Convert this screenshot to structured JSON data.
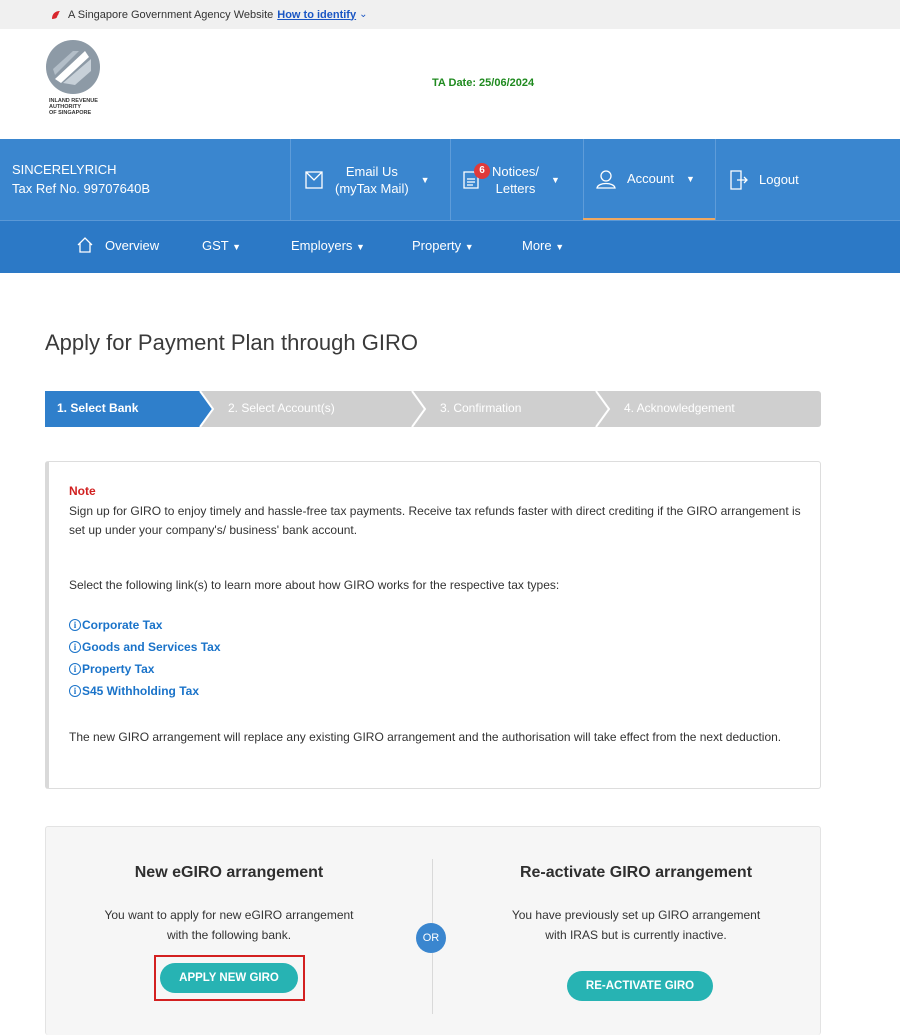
{
  "gov_banner": {
    "text": "A Singapore Government Agency Website",
    "identify_link": "How to identify"
  },
  "logo": {
    "line1": "INLAND REVENUE",
    "line2": "AUTHORITY",
    "line3": "OF SINGAPORE"
  },
  "ta_date": "TA Date: 25/06/2024",
  "user": {
    "name": "SINCERELYRICH",
    "tax_ref": "Tax Ref No. 99707640B"
  },
  "topnav": {
    "email_line1": "Email Us",
    "email_line2": "(myTax Mail)",
    "notices_line1": "Notices/",
    "notices_line2": "Letters",
    "notices_badge": "6",
    "account": "Account",
    "logout": "Logout"
  },
  "subnav": {
    "overview": "Overview",
    "gst": "GST",
    "employers": "Employers",
    "property": "Property",
    "more": "More"
  },
  "page_title": "Apply for Payment Plan through GIRO",
  "steps": [
    "1. Select Bank",
    "2. Select Account(s)",
    "3. Confirmation",
    "4. Acknowledgement"
  ],
  "note": {
    "title": "Note",
    "para1": "Sign up for GIRO to enjoy timely and hassle-free tax payments. Receive tax refunds faster with direct crediting if the GIRO arrangement is set up under your company's/ business' bank account.",
    "para2": "Select the following link(s) to learn more about how GIRO works for the respective tax types:",
    "links": [
      "Corporate Tax",
      "Goods and Services Tax",
      "Property Tax",
      "S45 Withholding Tax"
    ],
    "para3": "The new GIRO arrangement will replace any existing GIRO arrangement and the authorisation will take effect from the next deduction."
  },
  "giro": {
    "new_title": "New eGIRO arrangement",
    "new_text_line1": "You want to apply for new eGIRO arrangement",
    "new_text_line2": "with the following bank.",
    "new_button": "APPLY NEW GIRO",
    "or": "OR",
    "re_title": "Re-activate GIRO arrangement",
    "re_text_line1": "You have previously set up GIRO arrangement",
    "re_text_line2": "with IRAS but is currently inactive.",
    "re_button": "RE-ACTIVATE GIRO"
  },
  "colors": {
    "nav_blue": "#3a86cf",
    "subnav_blue": "#2c79c6",
    "active_step": "#2f7fcb",
    "inactive_step": "#cfcfcf",
    "button_teal": "#27b3b3",
    "note_red": "#d12020",
    "link_blue": "#1a73c9",
    "ta_date_green": "#1f8a1f"
  }
}
